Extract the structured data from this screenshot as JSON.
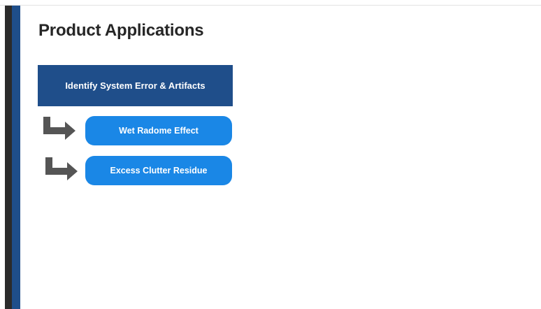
{
  "slide": {
    "title": "Product Applications",
    "header_box": "Identify System Error & Artifacts",
    "items": [
      {
        "label": "Wet Radome Effect",
        "icon": "bent-arrow-right-icon"
      },
      {
        "label": "Excess Clutter Residue",
        "icon": "bent-arrow-right-icon"
      }
    ]
  },
  "colors": {
    "accent_dark_blue": "#1f4e8a",
    "pill_blue": "#1a87e6",
    "left_bar_dark": "#2b2b2b",
    "arrow_gray": "#555555",
    "title_text": "#262626"
  }
}
